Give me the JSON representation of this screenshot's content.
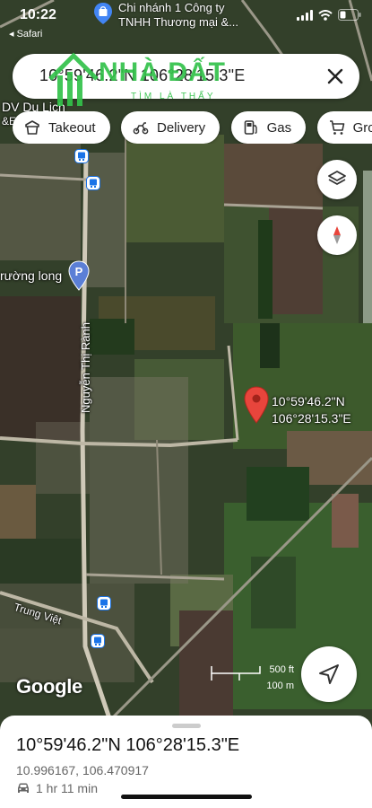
{
  "status_bar": {
    "time": "10:22",
    "back_app": "◂ Safari",
    "notification_line1": "Chi nhánh 1 Công ty",
    "notification_line2": "TNHH Thương mại &..."
  },
  "search": {
    "query": "10°59'46.2\"N 106°28'15.3\"E",
    "close_icon": "close-icon"
  },
  "watermark": {
    "brand": "NHÀ ĐẤT",
    "slogan": "TÌM LÀ THẤY"
  },
  "chips": [
    {
      "label": "Takeout",
      "icon": "takeout-icon"
    },
    {
      "label": "Delivery",
      "icon": "delivery-icon"
    },
    {
      "label": "Gas",
      "icon": "gas-icon"
    },
    {
      "label": "Groceri",
      "icon": "grocery-icon"
    }
  ],
  "map": {
    "labels": {
      "poi_top_left": "DV Du Lịch",
      "poi_top_left2": "&E",
      "poi_school": "rường long",
      "road_main": "Nguyễn Thị Rành",
      "road_bottom": "Trung Việt"
    },
    "pin": {
      "lat_text": "10°59'46.2\"N",
      "lng_text": "106°28'15.3\"E",
      "color": "#e8453c"
    },
    "scale": {
      "imperial": "500 ft",
      "metric": "100 m"
    },
    "attribution": "Google"
  },
  "sheet": {
    "title": "10°59'46.2\"N 106°28'15.3\"E",
    "decimal_coords": "10.996167, 106.470917",
    "drive_time": "1 hr 11 min"
  }
}
